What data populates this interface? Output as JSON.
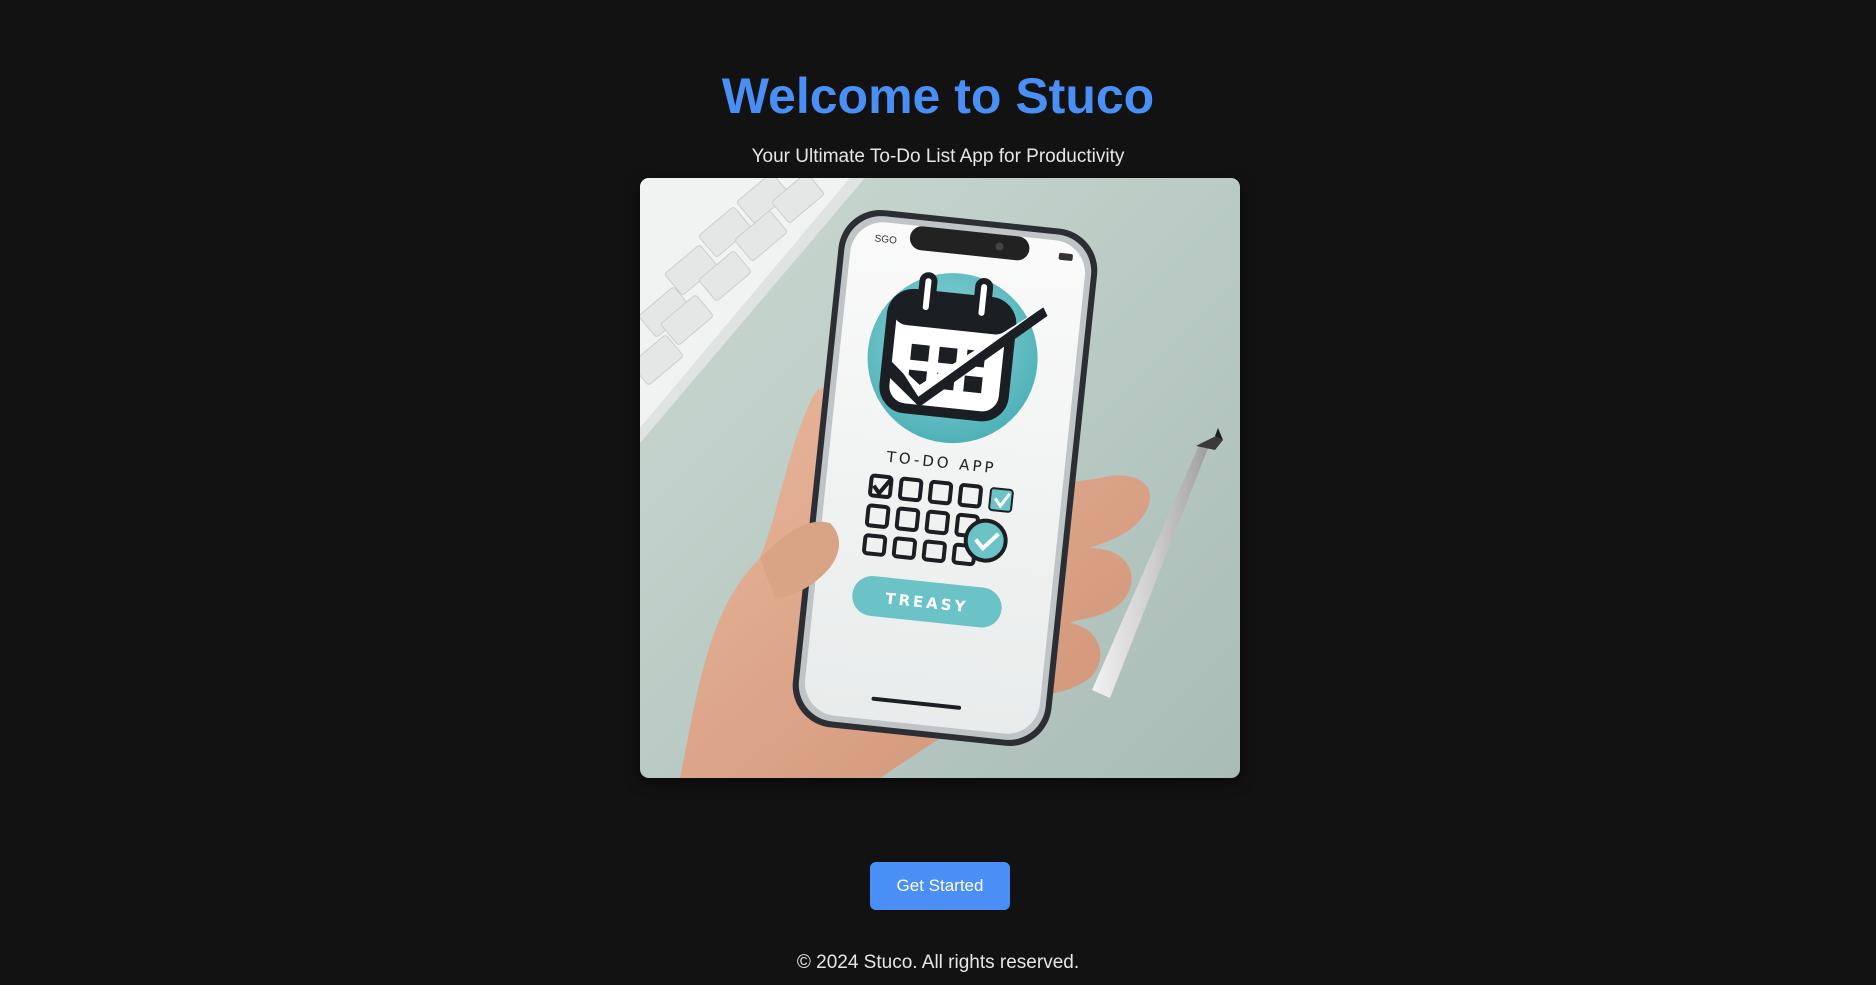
{
  "header": {
    "title": "Welcome to Stuco",
    "subtitle": "Your Ultimate To-Do List App for Productivity"
  },
  "hero": {
    "phone_app_title": "TO-DO APP",
    "phone_button_label": "TREASY",
    "phone_status_time": "SGO"
  },
  "cta": {
    "label": "Get Started"
  },
  "footer": {
    "text": "© 2024 Stuco. All rights reserved."
  },
  "colors": {
    "background": "#121212",
    "accent": "#4a8ff5",
    "text": "#e6e6e6",
    "teal": "#6cc3c7"
  }
}
